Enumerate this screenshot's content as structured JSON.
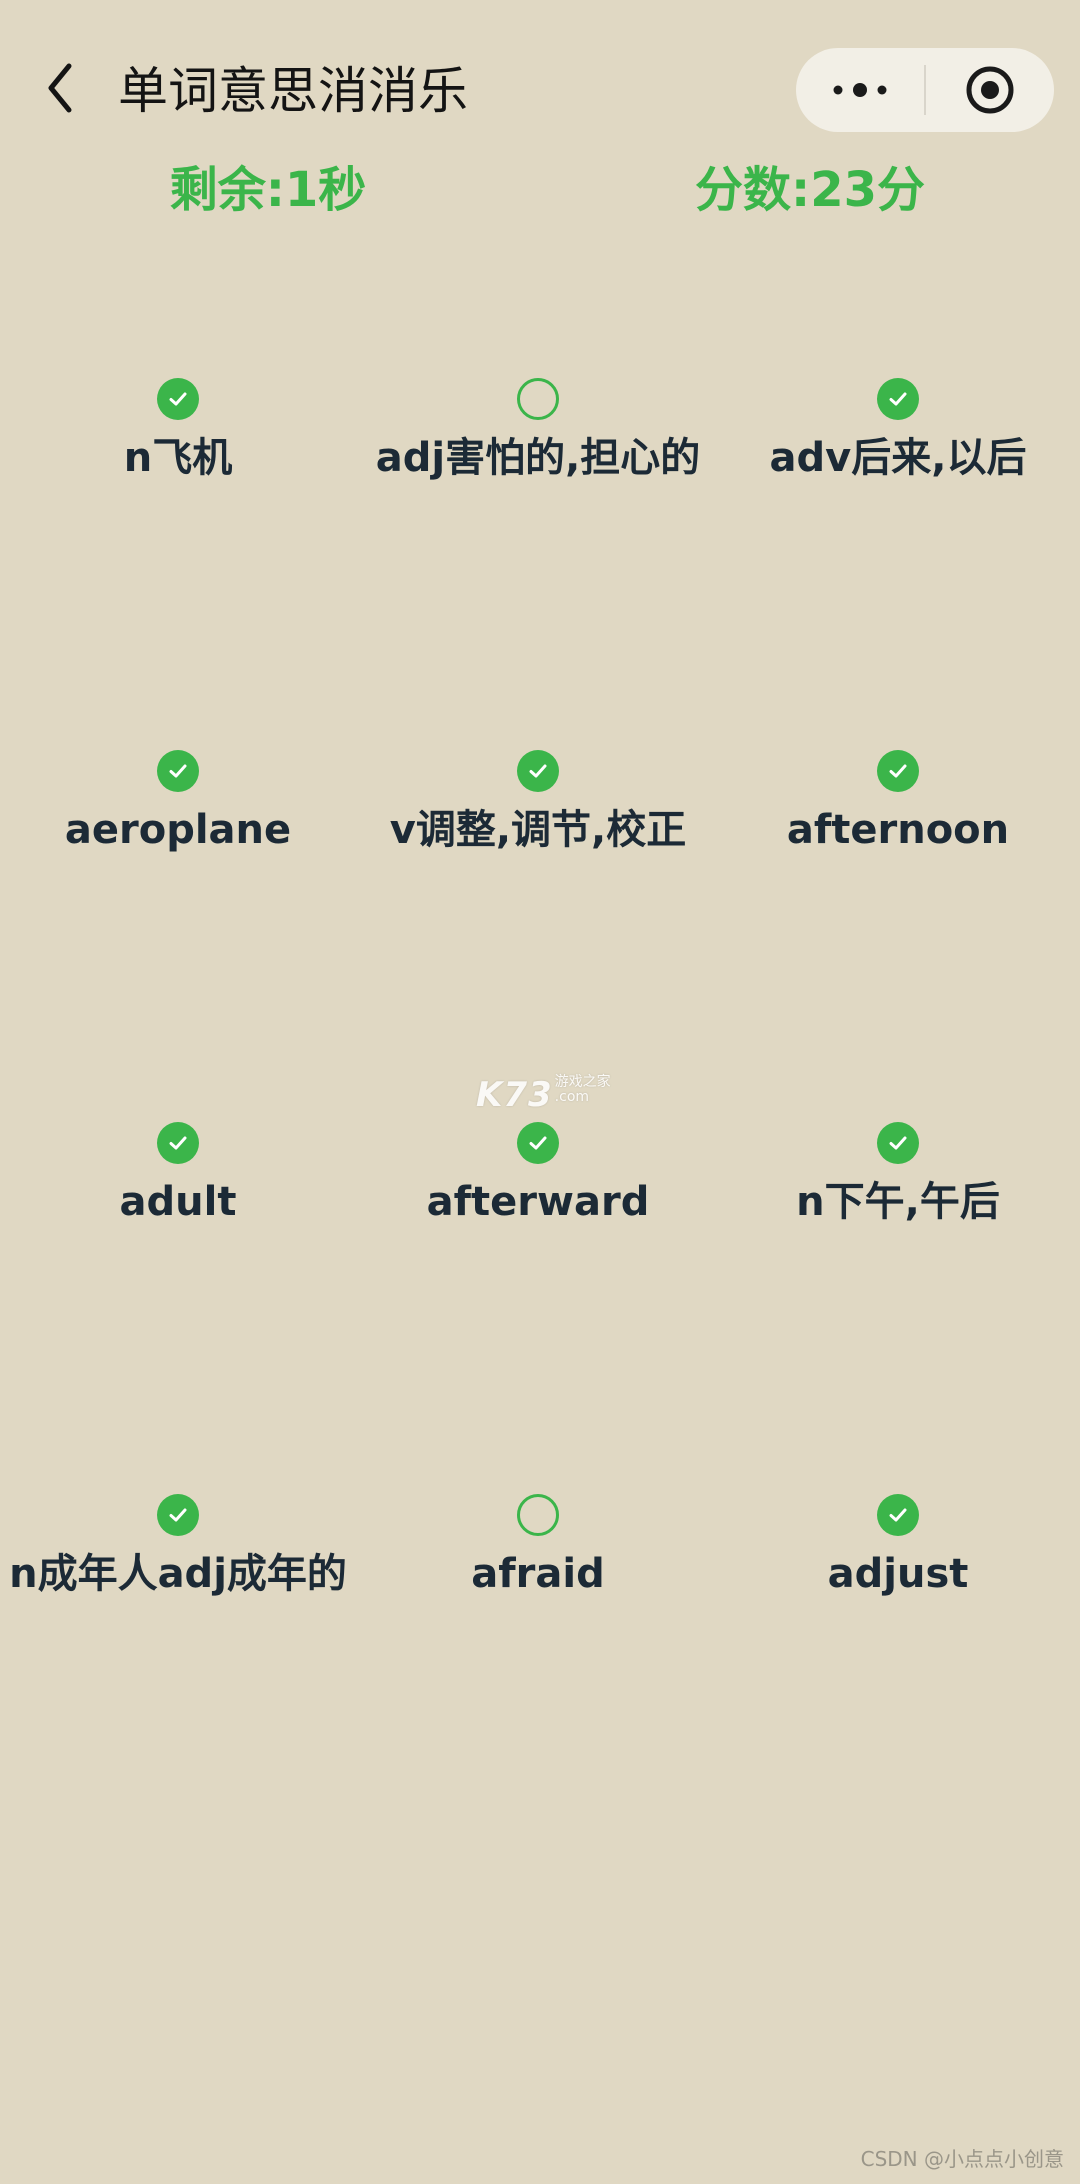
{
  "app": {
    "title": "单词意思消消乐"
  },
  "status": {
    "remaining": "剩余:1秒",
    "score": "分数:23分"
  },
  "cards": [
    {
      "text": "n飞机",
      "matched": true
    },
    {
      "text": "adj害怕的,担心的",
      "matched": false
    },
    {
      "text": "adv后来,以后",
      "matched": true
    },
    {
      "text": "aeroplane",
      "matched": true
    },
    {
      "text": "v调整,调节,校正",
      "matched": true
    },
    {
      "text": "afternoon",
      "matched": true
    },
    {
      "text": "adult",
      "matched": true
    },
    {
      "text": "afterward",
      "matched": true
    },
    {
      "text": "n下午,午后",
      "matched": true
    },
    {
      "text": "n成年人adj成年的",
      "matched": true
    },
    {
      "text": "afraid",
      "matched": false
    },
    {
      "text": "adjust",
      "matched": true
    }
  ],
  "watermark": {
    "main": "K73",
    "top": "游戏之家",
    "bottom": ".com"
  },
  "footer": "CSDN @小点点小创意",
  "colors": {
    "background": "#e0d8c3",
    "accent": "#3bb54a",
    "text": "#1c2a36"
  }
}
